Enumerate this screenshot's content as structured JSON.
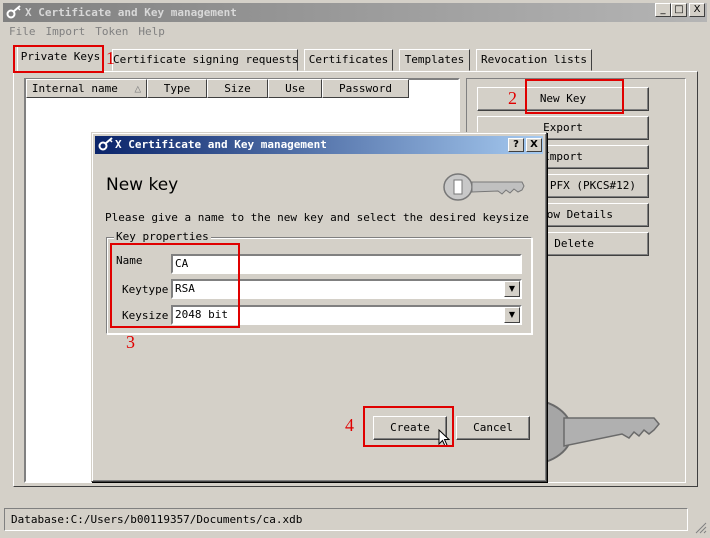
{
  "window": {
    "title": "X Certificate and Key management",
    "min_glyph": "_",
    "max_glyph": "□",
    "close_glyph": "X"
  },
  "menu": [
    "File",
    "Import",
    "Token",
    "Help"
  ],
  "tabs": [
    {
      "label": "Private Keys"
    },
    {
      "label": "Certificate signing requests"
    },
    {
      "label": "Certificates"
    },
    {
      "label": "Templates"
    },
    {
      "label": "Revocation lists"
    }
  ],
  "columns": [
    {
      "label": "Internal name"
    },
    {
      "label": "Type"
    },
    {
      "label": "Size"
    },
    {
      "label": "Use"
    },
    {
      "label": "Password"
    }
  ],
  "sort_glyph": "△",
  "right_buttons": [
    {
      "label": "New Key"
    },
    {
      "label": "Export"
    },
    {
      "label": "Import"
    },
    {
      "label": "t PFX (PKCS#12)"
    },
    {
      "label": "how Details"
    },
    {
      "label": "Delete"
    }
  ],
  "status": "Database:C:/Users/b00119357/Documents/ca.xdb",
  "dialog": {
    "title": "X Certificate and Key management",
    "help_glyph": "?",
    "close_glyph": "X",
    "heading": "New key",
    "description": "Please give a name to the new key and select the desired keysize",
    "group_title": "Key properties",
    "name_label": "Name",
    "name_value": "CA",
    "keytype_label": "Keytype",
    "keytype_value": "RSA",
    "keysize_label": "Keysize",
    "keysize_value": "2048 bit",
    "create_label": "Create",
    "cancel_label": "Cancel"
  },
  "annotations": [
    "1",
    "2",
    "3",
    "4"
  ],
  "colors": {
    "annotation": "#e00000",
    "dialog_title": "#0a246a",
    "inactive_title": "#808080"
  },
  "icons": [
    "key-icon",
    "key-graphic"
  ]
}
